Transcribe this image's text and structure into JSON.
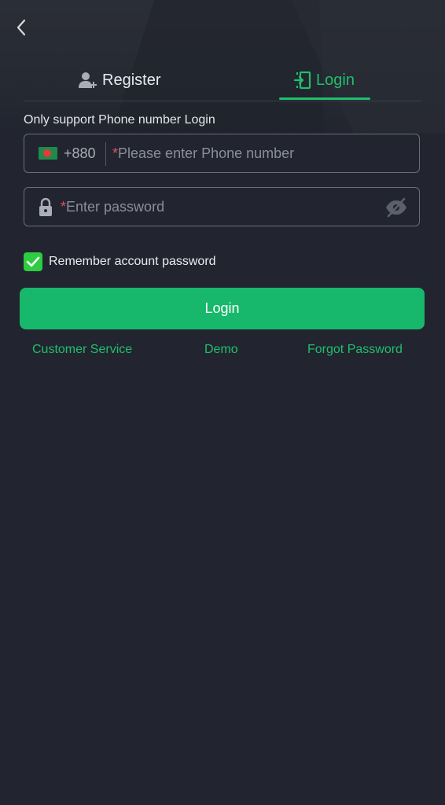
{
  "header": {
    "back_icon": "chevron-left-icon"
  },
  "tabs": [
    {
      "label": "Register",
      "icon": "user-add-icon",
      "active": false
    },
    {
      "label": "Login",
      "icon": "login-door-icon",
      "active": true
    }
  ],
  "form": {
    "hint": "Only support Phone number Login",
    "phone": {
      "country_flag": "bangladesh-flag-icon",
      "country_code": "+880",
      "required_mark": "*",
      "placeholder": "Please enter Phone number",
      "value": ""
    },
    "password": {
      "lock_icon": "lock-icon",
      "required_mark": "*",
      "placeholder": "Enter password",
      "value": "",
      "visibility_icon": "eye-off-icon"
    },
    "remember": {
      "checked": true,
      "label": "Remember account password"
    },
    "submit_label": "Login"
  },
  "links": {
    "customer_service": "Customer Service",
    "demo": "Demo",
    "forgot_password": "Forgot Password"
  },
  "colors": {
    "background": "#22252f",
    "accent_green": "#1fbf6d",
    "button_green": "#17b86b",
    "checkbox_green": "#2ecc40",
    "required_red": "#e0506a"
  }
}
